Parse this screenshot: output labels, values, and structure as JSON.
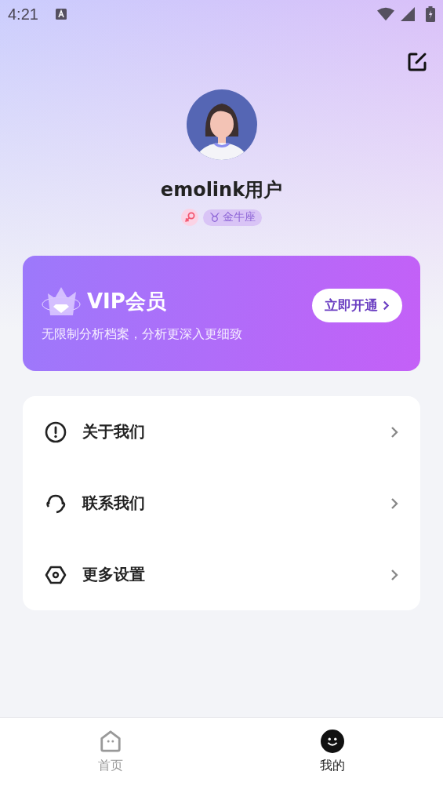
{
  "status_bar": {
    "time": "4:21"
  },
  "profile": {
    "name": "emolink用户",
    "zodiac": {
      "symbol": "♉",
      "label": "金牛座"
    }
  },
  "vip": {
    "title": "VIP会员",
    "subtitle": "无限制分析档案，分析更深入更细致",
    "button": "立即开通"
  },
  "menu": [
    {
      "kind": "about",
      "label": "关于我们"
    },
    {
      "kind": "contact",
      "label": "联系我们"
    },
    {
      "kind": "settings",
      "label": "更多设置"
    }
  ],
  "tabs": [
    {
      "kind": "home",
      "label": "首页",
      "selected": false
    },
    {
      "kind": "me",
      "label": "我的",
      "selected": true
    }
  ]
}
